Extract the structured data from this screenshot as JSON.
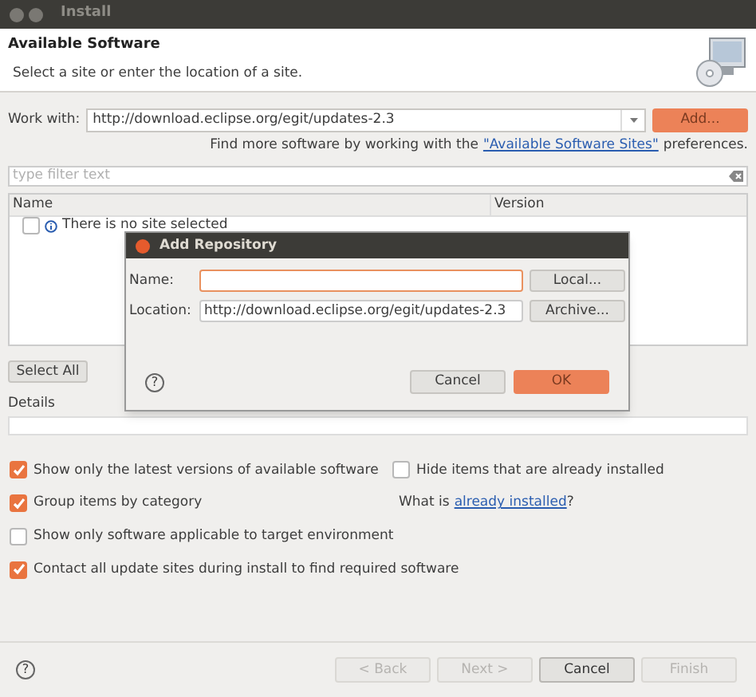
{
  "window": {
    "title": "Install"
  },
  "header": {
    "title": "Available Software",
    "subtitle": "Select a site or enter the location of a site."
  },
  "work_with": {
    "label": "Work with:",
    "value": "http://download.eclipse.org/egit/updates-2.3",
    "add_button": "Add..."
  },
  "sites_line": {
    "before": "Find more software by working with the",
    "link": "\"Available Software Sites\"",
    "after": "preferences."
  },
  "filter": {
    "placeholder": "type filter text"
  },
  "table": {
    "columns": [
      "Name",
      "Version"
    ],
    "rows": [
      {
        "name": "There is no site selected",
        "checked": false
      }
    ]
  },
  "select_all_button": "Select All",
  "details": {
    "label": "Details"
  },
  "options": [
    {
      "label": "Show only the latest versions of available software",
      "checked": true
    },
    {
      "label": "Hide items that are already installed",
      "checked": false
    },
    {
      "label": "Group items by category",
      "checked": true
    },
    {
      "label": "Show only software applicable to target environment",
      "checked": false
    },
    {
      "label": "Contact all update sites during install to find required software",
      "checked": true
    }
  ],
  "installed_line": {
    "before": "What is",
    "link": "already installed",
    "after": "?"
  },
  "footer": {
    "help": "?",
    "buttons": [
      {
        "label": "< Back",
        "disabled": true
      },
      {
        "label": "Next >",
        "disabled": true
      },
      {
        "label": "Cancel",
        "disabled": false
      },
      {
        "label": "Finish",
        "disabled": true
      }
    ]
  },
  "dialog": {
    "title": "Add Repository",
    "name_label": "Name:",
    "location_label": "Location:",
    "location_value": "http://download.eclipse.org/egit/updates-2.3",
    "local_button": "Local...",
    "archive_button": "Archive...",
    "help": "?",
    "cancel_button": "Cancel",
    "ok_button": "OK"
  }
}
